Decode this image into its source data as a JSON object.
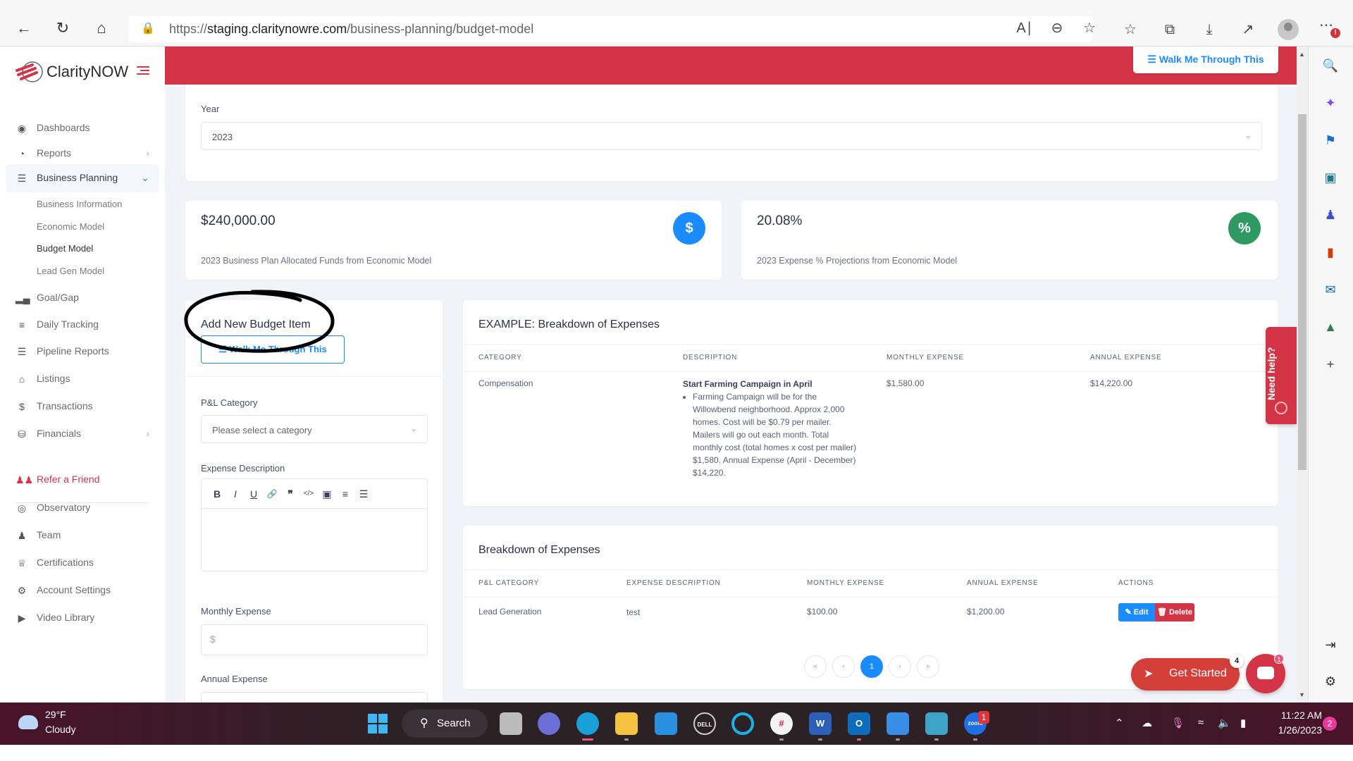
{
  "browser": {
    "url_prefix": "https://",
    "url_host": "staging.claritynowre.com",
    "url_path": "/business-planning/budget-model",
    "toolbar_icons": [
      "back-icon",
      "refresh-icon",
      "home-icon",
      "lock-icon",
      "read-aloud-icon",
      "zoom-out-icon",
      "add-favorite-icon",
      "favorites-icon",
      "collections-icon",
      "downloads-icon",
      "share-icon",
      "profile-icon",
      "more-icon"
    ],
    "more_badge": "!"
  },
  "app": {
    "logo_text": "ClarityNOW",
    "walk_me_label": "Walk Me Through This"
  },
  "sidebar": {
    "items": [
      {
        "label": "Dashboards",
        "icon": "dashboard-icon"
      },
      {
        "label": "Reports",
        "icon": "pie-chart-icon",
        "has_chevron": true
      },
      {
        "label": "Business Planning",
        "icon": "checklist-icon",
        "expanded": true,
        "active": true
      },
      {
        "label": "Goal/Gap",
        "icon": "signal-bars-icon"
      },
      {
        "label": "Daily Tracking",
        "icon": "list-icon"
      },
      {
        "label": "Pipeline Reports",
        "icon": "lines-icon"
      },
      {
        "label": "Listings",
        "icon": "home-icon"
      },
      {
        "label": "Transactions",
        "icon": "dollar-icon"
      },
      {
        "label": "Financials",
        "icon": "coins-icon",
        "has_chevron": true
      },
      {
        "label": "Refer a Friend",
        "icon": "users-icon"
      },
      {
        "label": "Observatory",
        "icon": "eye-icon"
      },
      {
        "label": "Team",
        "icon": "team-icon"
      },
      {
        "label": "Certifications",
        "icon": "crown-icon"
      },
      {
        "label": "Account Settings",
        "icon": "gear-icon"
      },
      {
        "label": "Video Library",
        "icon": "play-icon"
      }
    ],
    "sub_items": [
      {
        "label": "Business Information"
      },
      {
        "label": "Economic Model"
      },
      {
        "label": "Budget Model",
        "active": true
      },
      {
        "label": "Lead Gen Model"
      }
    ]
  },
  "year_filter": {
    "label": "Year",
    "value": "2023"
  },
  "stats": [
    {
      "value": "$240,000.00",
      "description": "2023 Business Plan Allocated Funds from Economic Model",
      "icon": "$",
      "color": "#1a8cff"
    },
    {
      "value": "20.08%",
      "description": "2023 Expense % Projections from Economic Model",
      "icon": "%",
      "color": "#2e9960"
    }
  ],
  "add_item": {
    "title": "Add New Budget Item",
    "walk_me_label": "Walk Me Through This",
    "category_label": "P&L Category",
    "category_placeholder": "Please select a category",
    "description_label": "Expense Description",
    "editor_tools": [
      "bold-icon",
      "italic-icon",
      "underline-icon",
      "link-icon",
      "quote-icon",
      "code-icon",
      "image-icon",
      "ordered-list-icon",
      "bullet-list-icon"
    ],
    "editor_glyphs": [
      "B",
      "I",
      "U",
      "🔗",
      "❞",
      "</>",
      "▣",
      "≡",
      "☰"
    ],
    "monthly_label": "Monthly Expense",
    "monthly_prefix": "$",
    "annual_label": "Annual Expense"
  },
  "example_table": {
    "title": "EXAMPLE: Breakdown of Expenses",
    "headers": [
      "CATEGORY",
      "DESCRIPTION",
      "MONTHLY EXPENSE",
      "ANNUAL EXPENSE"
    ],
    "rows": [
      {
        "category": "Compensation",
        "description_title": "Start Farming Campaign in April",
        "description_bullet": "Farming Campaign will be for the Willowbend neighborhood. Approx 2,000 homes. Cost will be $0.79 per mailer. Mailers will go out each month. Total monthly cost (total homes x cost per mailer) $1,580. Annual Expense (April - December) $14,220.",
        "monthly": "$1,580.00",
        "annual": "$14,220.00"
      }
    ]
  },
  "breakdown_table": {
    "title": "Breakdown of Expenses",
    "headers": [
      "P&L CATEGORY",
      "EXPENSE DESCRIPTION",
      "MONTHLY EXPENSE",
      "ANNUAL EXPENSE",
      "ACTIONS"
    ],
    "rows": [
      {
        "category": "Lead Generation",
        "description": "test",
        "monthly": "$100.00",
        "annual": "$1,200.00",
        "edit_label": "Edit",
        "delete_label": "Delete"
      }
    ],
    "pagination": {
      "first": "«",
      "prev": "‹",
      "current": "1",
      "next": "›",
      "last": "»"
    }
  },
  "widgets": {
    "need_help_label": "Need help?",
    "get_started_label": "Get Started",
    "get_started_badge": "4",
    "chat_badge": "1"
  },
  "taskbar": {
    "weather_temp": "29°F",
    "weather_condition": "Cloudy",
    "search_label": "Search",
    "apps": [
      "task-view",
      "teams-chat",
      "edge",
      "file-explorer",
      "mail",
      "dell",
      "cortana",
      "slack",
      "word",
      "outlook",
      "photos",
      "notepad",
      "zoom"
    ],
    "zoom_badge": "1",
    "time": "11:22 AM",
    "date": "1/26/2023",
    "notification_count": "2"
  },
  "colors": {
    "brand_red": "#d43546",
    "accent_blue": "#1a8cff",
    "success_green": "#2e9960"
  }
}
